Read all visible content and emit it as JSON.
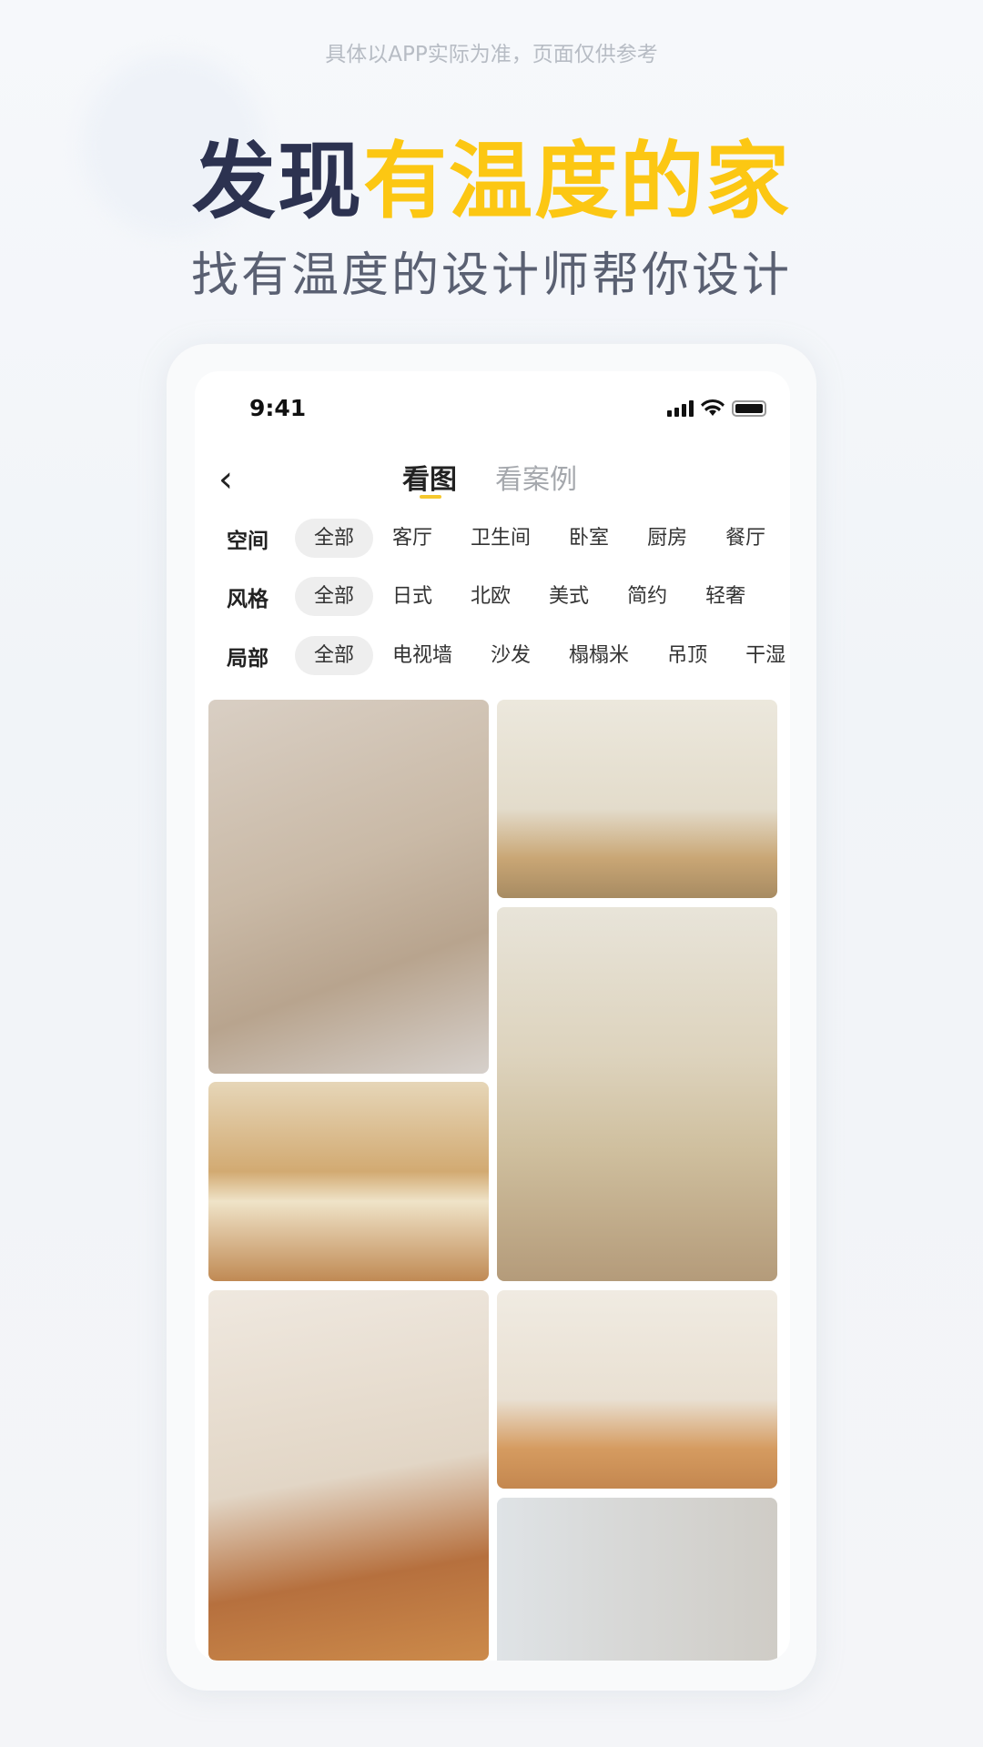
{
  "note": "具体以APP实际为准，页面仅供参考",
  "title": {
    "part1": "发现",
    "part2": "有温度的家"
  },
  "subtitle": "找有温度的设计师帮你设计",
  "phone": {
    "time": "9:41",
    "tabs": [
      {
        "label": "看图",
        "active": true
      },
      {
        "label": "看案例",
        "active": false
      }
    ],
    "filters": [
      {
        "label": "空间",
        "options": [
          "全部",
          "客厅",
          "卫生间",
          "卧室",
          "厨房",
          "餐厅"
        ],
        "selected": "全部"
      },
      {
        "label": "风格",
        "options": [
          "全部",
          "日式",
          "北欧",
          "美式",
          "简约",
          "轻奢"
        ],
        "selected": "全部"
      },
      {
        "label": "局部",
        "options": [
          "全部",
          "电视墙",
          "沙发",
          "榻榻米",
          "吊顶",
          "干湿"
        ],
        "selected": "全部"
      }
    ],
    "photos": [
      "living-room-sofa",
      "dining-kitchen-art",
      "dining-bookshelves",
      "kitchen-shelves",
      "dining-table-lamp",
      "living-room-art",
      "room-red-pendant"
    ]
  }
}
